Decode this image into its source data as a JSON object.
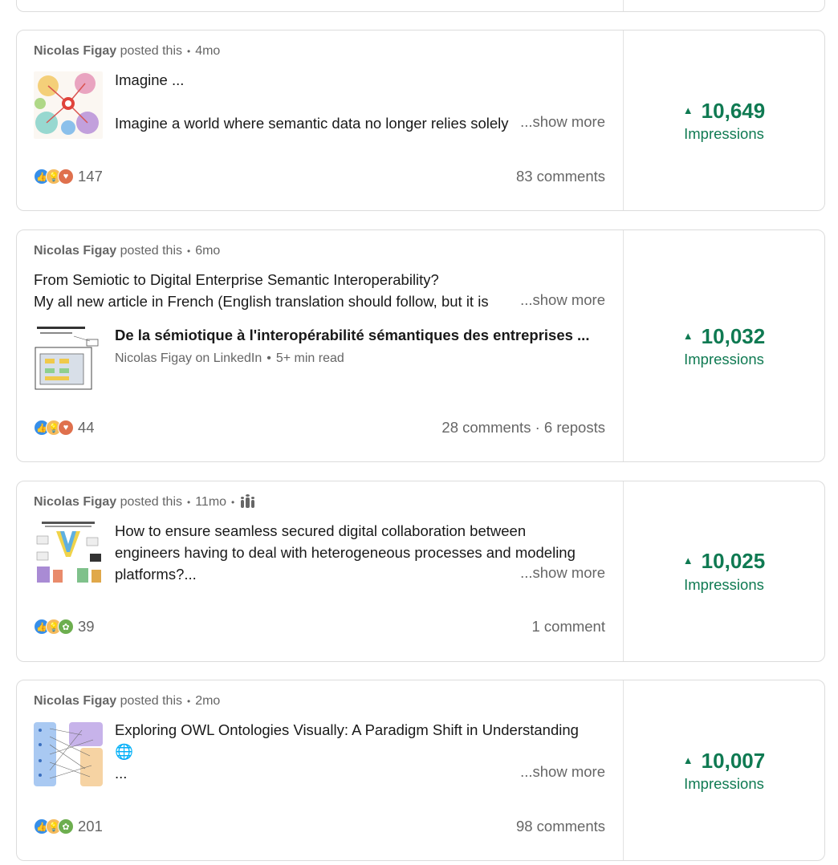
{
  "posts": [
    {
      "author": "Nicolas Figay",
      "action": "posted this",
      "time": "4mo",
      "line1": "Imagine ...",
      "line2": "Imagine a world where semantic data no longer relies solely",
      "show_more": "...show more",
      "reaction_count": "147",
      "engagement": "83 comments",
      "impressions": "10,649",
      "impressions_label": "Impressions"
    },
    {
      "author": "Nicolas Figay",
      "action": "posted this",
      "time": "6mo",
      "line1": "From Semiotic to Digital Enterprise Semantic Interoperability?",
      "line2": "My all new article in French (English translation should follow, but it is",
      "show_more": "...show more",
      "article_title": "De la sémiotique à l'interopérabilité sémantiques des entreprises ...",
      "article_source": "Nicolas Figay on LinkedIn",
      "article_read": "5+ min read",
      "reaction_count": "44",
      "engagement": "28 comments · 6 reposts",
      "impressions": "10,032",
      "impressions_label": "Impressions"
    },
    {
      "author": "Nicolas Figay",
      "action": "posted this",
      "time": "11mo",
      "line1": "How to ensure seamless secured digital collaboration between",
      "line2": "engineers having to deal with heterogeneous processes and modeling",
      "line3": "platforms?...",
      "show_more": "...show more",
      "reaction_count": "39",
      "engagement": "1 comment",
      "impressions": "10,025",
      "impressions_label": "Impressions"
    },
    {
      "author": "Nicolas Figay",
      "action": "posted this",
      "time": "2mo",
      "line1": "Exploring OWL Ontologies Visually: A Paradigm Shift in Understanding",
      "line2": "🌐",
      "line3": "...",
      "show_more": "...show more",
      "reaction_count": "201",
      "engagement": "98 comments",
      "impressions": "10,007",
      "impressions_label": "Impressions"
    }
  ],
  "colors": {
    "impressions_green": "#0f7a52",
    "muted_text": "#666666",
    "like_blue": "#378fe9",
    "insight_yellow": "#f5bb5c",
    "love_red": "#df704d",
    "support_green": "#6dae4f"
  }
}
